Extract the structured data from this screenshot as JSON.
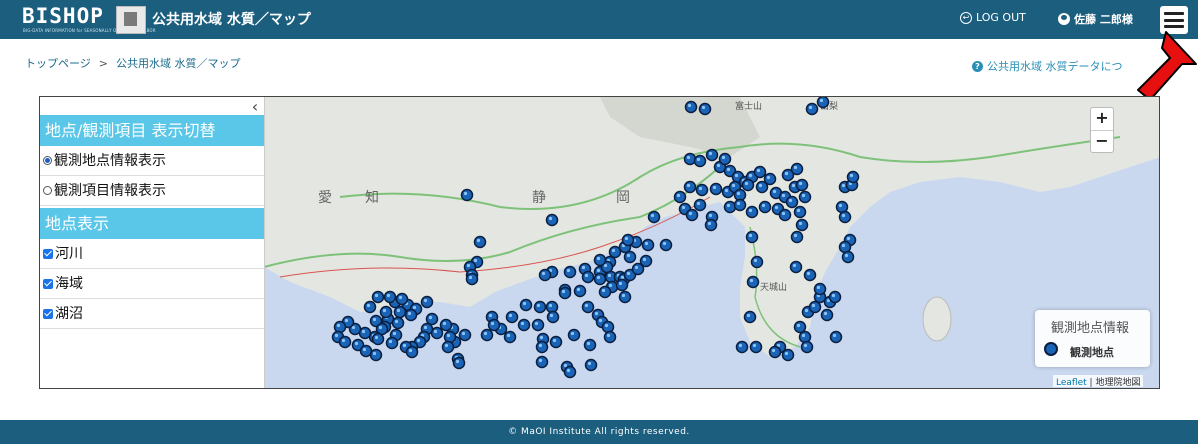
{
  "header": {
    "logo": "BISHOP",
    "logo_sub": "BIG-DATA INFORMATION for SEASONALLY OPERATED HARBOR",
    "app_title": "公共用水域 水質／マップ",
    "logout_label": "LOG OUT",
    "user_name": "佐藤 二郎様",
    "brand_color": "#1b5e7e"
  },
  "breadcrumb": {
    "home": "トップページ",
    "separator": ">",
    "current": "公共用水域 水質／マップ"
  },
  "help_link": "公共用水域 水質データにつ",
  "panel": {
    "section1_title": "地点/観測項目 表示切替",
    "radios": [
      {
        "label": "観測地点情報表示",
        "checked": true
      },
      {
        "label": "観測項目情報表示",
        "checked": false
      }
    ],
    "section2_title": "地点表示",
    "checks": [
      {
        "label": "河川",
        "checked": true
      },
      {
        "label": "海域",
        "checked": true
      },
      {
        "label": "湖沼",
        "checked": true
      }
    ]
  },
  "map": {
    "zoom_in": "+",
    "zoom_out": "−",
    "labels": [
      "富士山",
      "山梨",
      "静",
      "岡",
      "愛",
      "知",
      "天城山"
    ],
    "legend_title": "観測地点情報",
    "legend_item": "観測地点",
    "attribution_leaflet": "Leaflet",
    "attribution_sep": "|",
    "attribution_source": "地理院地図"
  },
  "footer": "© MaOI Institute All rights reserved."
}
